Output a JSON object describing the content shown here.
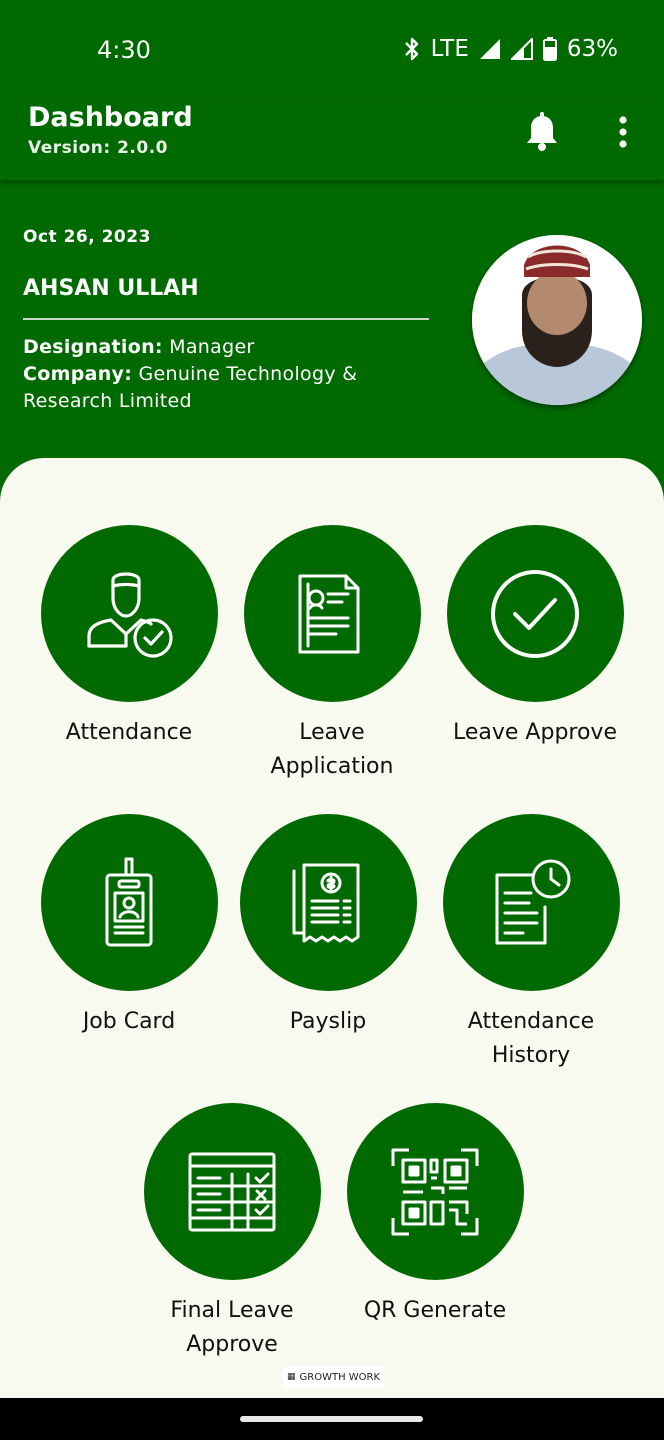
{
  "status": {
    "time": "4:30",
    "network": "LTE",
    "battery": "63%"
  },
  "appbar": {
    "title": "Dashboard",
    "version": "Version: 2.0.0"
  },
  "profile": {
    "date": "Oct 26, 2023",
    "name": "AHSAN ULLAH",
    "designation_label": "Designation:",
    "designation": "Manager",
    "company_label": "Company:",
    "company": "Genuine Technology & Research Limited"
  },
  "menu": [
    {
      "label": "Attendance",
      "icon": "employee-check-icon"
    },
    {
      "label": "Leave Application",
      "icon": "document-icon"
    },
    {
      "label": "Leave Approve",
      "icon": "check-circle-icon"
    },
    {
      "label": "Job Card",
      "icon": "id-card-icon"
    },
    {
      "label": "Payslip",
      "icon": "receipt-icon"
    },
    {
      "label": "Attendance History",
      "icon": "history-clock-icon"
    },
    {
      "label": "Final Leave Approve",
      "icon": "table-check-icon"
    },
    {
      "label": "QR Generate",
      "icon": "qr-code-icon"
    }
  ],
  "footer": {
    "badge": "GROWTH WORK"
  },
  "colors": {
    "primary": "#006a00",
    "background": "#f8faf0"
  }
}
